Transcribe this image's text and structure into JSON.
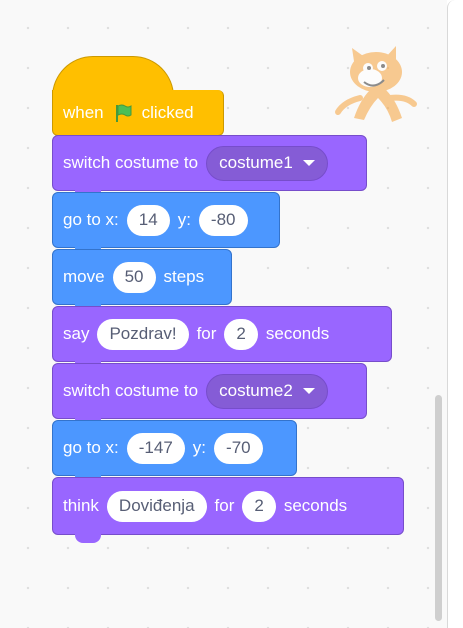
{
  "script": {
    "hat": {
      "when": "when",
      "clicked": "clicked",
      "flag_icon": "green-flag-icon"
    },
    "blocks": [
      {
        "prefix": "switch costume to",
        "costume": "costume1"
      },
      {
        "prefix": "go to x:",
        "x": "14",
        "y_label": "y:",
        "y": "-80"
      },
      {
        "prefix": "move",
        "steps": "50",
        "suffix": "steps"
      },
      {
        "prefix": "say",
        "message": "Pozdrav!",
        "for": "for",
        "secs": "2",
        "suffix": "seconds"
      },
      {
        "prefix": "switch costume to",
        "costume": "costume2"
      },
      {
        "prefix": "go to x:",
        "x": "-147",
        "y_label": "y:",
        "y": "-70"
      },
      {
        "prefix": "think",
        "message": "Doviđenja",
        "for": "for",
        "secs": "2",
        "suffix": "seconds"
      }
    ]
  },
  "sprite": {
    "icon": "scratch-cat-icon"
  },
  "colors": {
    "events": "#ffbf00",
    "looks": "#9966ff",
    "motion": "#4c97ff"
  }
}
